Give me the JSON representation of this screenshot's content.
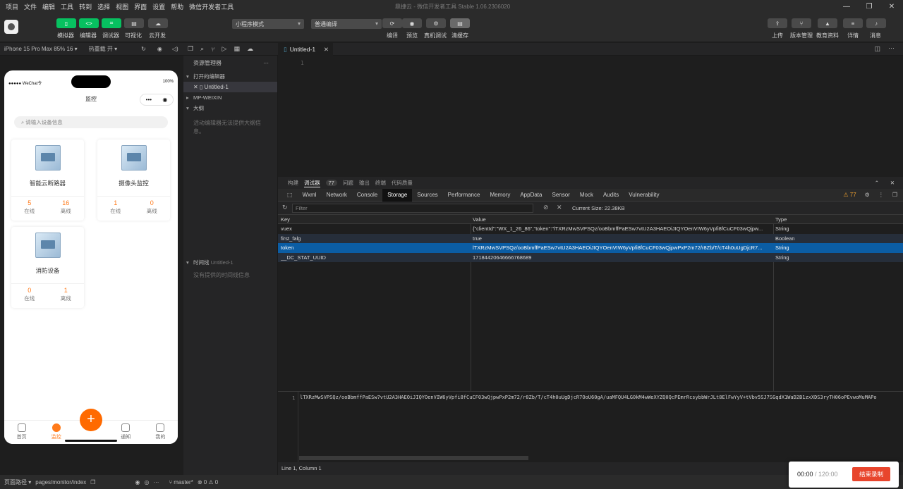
{
  "menubar": {
    "items": [
      "项目",
      "文件",
      "编辑",
      "工具",
      "转到",
      "选择",
      "视图",
      "界面",
      "设置",
      "帮助",
      "微信开发者工具"
    ],
    "window_title": "鼎捷云 - 微信开发者工具 Stable 1.06.2306020"
  },
  "toolbar": {
    "left_buttons": [
      "模拟器",
      "编辑器",
      "调试器",
      "可视化",
      "云开发"
    ],
    "mode_select": "小程序模式",
    "compile_select": "普通编译",
    "mid_buttons": [
      "编译",
      "预览",
      "真机调试",
      "清缓存"
    ],
    "right_buttons": [
      "上传",
      "版本管理",
      "教育资料",
      "详情",
      "消息"
    ]
  },
  "simulator": {
    "device": "iPhone 15 Pro Max 85% 16 ▾",
    "hot_reload": "热重载 开 ▾",
    "status_carrier": "●●●●● WeChat令",
    "status_battery": "100%",
    "nav_title": "监控",
    "search_placeholder": "请输入设备信息",
    "cards": [
      {
        "name": "智能云断路器",
        "stats": [
          {
            "value": "5",
            "label": "在线"
          },
          {
            "value": "16",
            "label": "离线"
          }
        ]
      },
      {
        "name": "摄像头监控",
        "stats": [
          {
            "value": "1",
            "label": "在线"
          },
          {
            "value": "0",
            "label": "离线"
          }
        ]
      },
      {
        "name": "消防设备",
        "stats": [
          {
            "value": "0",
            "label": "在线"
          },
          {
            "value": "1",
            "label": "离线"
          }
        ]
      }
    ],
    "tabs": [
      "首页",
      "监控",
      "通知",
      "我的"
    ],
    "fab": "+"
  },
  "explorer": {
    "title": "资源管理器",
    "more": "···",
    "open_editors": "打开的编辑器",
    "open_file": "Untitled-1",
    "project": "MP-WEIXIN",
    "outline": "大纲",
    "outline_note": "活动编辑器无法提供大纲信息。",
    "timeline": "时间线",
    "timeline_file": "Untitled-1",
    "timeline_note": "没有提供的时间线信息"
  },
  "editor": {
    "tab_label": "Untitled-1",
    "line_number": "1"
  },
  "devtools": {
    "top_tabs": [
      "构建",
      "调试器",
      "问题",
      "输出",
      "终端",
      "代码质量"
    ],
    "issues_count": "77",
    "tabs": [
      "Wxml",
      "Network",
      "Console",
      "Storage",
      "Sources",
      "Performance",
      "Memory",
      "AppData",
      "Sensor",
      "Mock",
      "Audits",
      "Vulnerability"
    ],
    "warning_count": "77",
    "filter_placeholder": "Filter",
    "current_size": "Current Size: 22.38KB",
    "columns": [
      "Key",
      "Value",
      "Type"
    ],
    "rows": [
      {
        "key": "vuex",
        "value": "{\"clientId\":\"WX_1_26_86\",\"token\":\"lTXRzMwSVPSQz/ooBbmffPaESw7vtU2A3HAEOiJIQYOenVIW6yVpfi8fCuCF03wQjpw...",
        "type": "String"
      },
      {
        "key": "first_falg",
        "value": "true",
        "type": "Boolean"
      },
      {
        "key": "token",
        "value": "lTXRzMwSVPSQz/ooBbmffPaESw7vtU2A3HAEOiJIQYOenVIW6yVpfi8fCuCF03wQjpwPxP2m72/r8Zb/T/cT4h0uUgDjcR7...",
        "type": "String"
      },
      {
        "key": "__DC_STAT_UUID",
        "value": "17184420646666768689",
        "type": "String"
      }
    ],
    "preview_line": "1",
    "preview_text": "lTXRzMwSVPSQz/ooBbmffPaESw7vtU2A3HAEOiJIQYOenVIW6yVpfi8fCuCF03wQjpwPxP2m72/r8Zb/T/cT4h0uUgDjcR7OoU60gA/uaMFQU4LG0kM4wWeXYZQ0QcPEmrRcsybbWrJLt8ElFwYyV+tVbv5SJ7SGqdX1WaD2B1zxXDS3ryTH06oPEvwoMuMAPo",
    "status": "Line 1, Column 1"
  },
  "statusbar": {
    "page_path_label": "页面路径 ▾",
    "page_path": "pages/monitor/index",
    "branch": "master*",
    "errors": "⊗ 0 ⚠ 0"
  },
  "recorder": {
    "elapsed": "00:00",
    "total": " / 120:00",
    "stop_label": "结束录制"
  }
}
